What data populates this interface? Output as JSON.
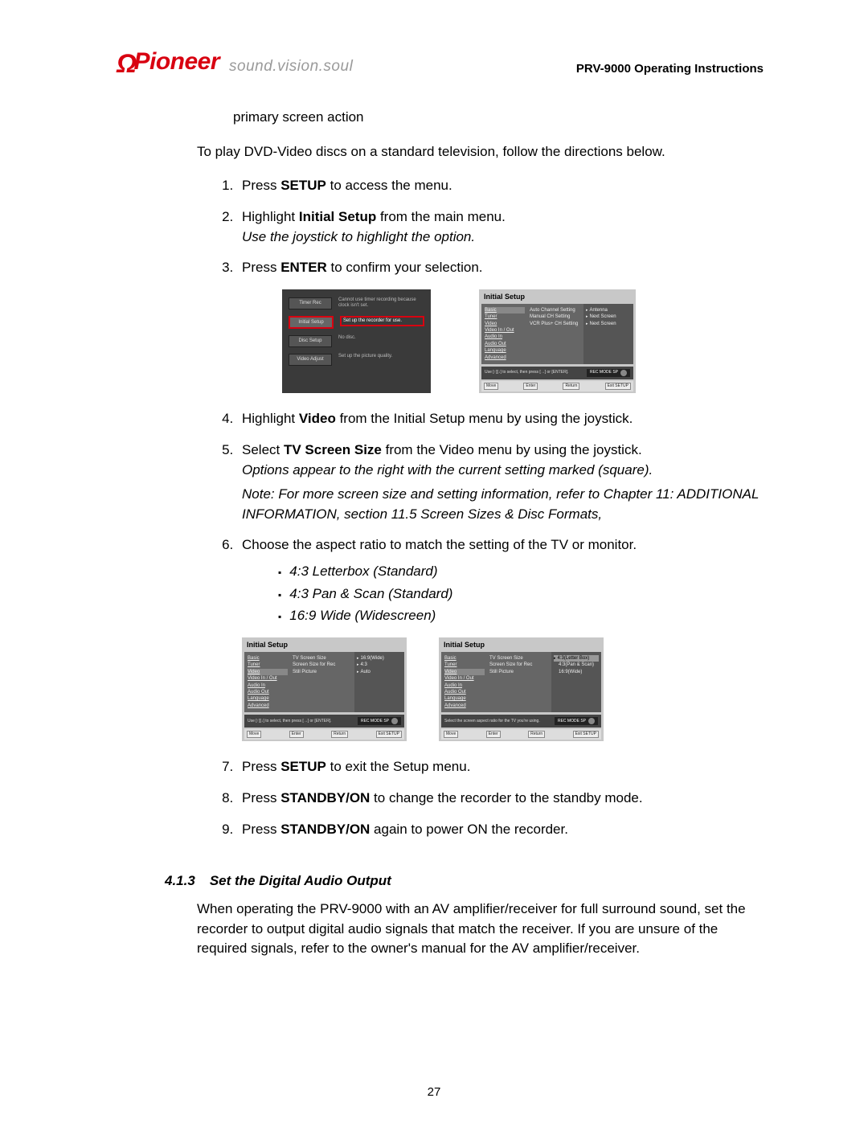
{
  "header": {
    "logo": "Pioneer",
    "tagline": "sound.vision.soul",
    "doc_title": "PRV-9000 Operating Instructions"
  },
  "indent_text": "primary screen action",
  "intro": "To play DVD-Video discs on a standard television, follow the directions below.",
  "steps": {
    "s1_a": "Press ",
    "s1_b": "SETUP",
    "s1_c": " to access the menu.",
    "s2_a": "Highlight ",
    "s2_b": "Initial Setup",
    "s2_c": " from the main menu.",
    "s2_hint": "Use the joystick to highlight the option.",
    "s3_a": "Press ",
    "s3_b": "ENTER",
    "s3_c": " to confirm your selection.",
    "s4_a": "Highlight ",
    "s4_b": "Video",
    "s4_c": " from the Initial Setup menu by using the joystick.",
    "s5_a": "Select ",
    "s5_b": "TV Screen Size",
    "s5_c": " from the Video menu by using the joystick.",
    "s5_hint": "Options appear to the right with the current setting marked (square).",
    "s5_note": "Note: For more screen size and setting information, refer to Chapter 11: ADDITIONAL INFORMATION, section 11.5 Screen Sizes & Disc Formats,",
    "s6": "Choose the aspect ratio to match the setting of the TV or monitor.",
    "s6_b1": "4:3 Letterbox (Standard)",
    "s6_b2": "4:3 Pan & Scan (Standard)",
    "s6_b3": "16:9 Wide (Widescreen)",
    "s7_a": "Press ",
    "s7_b": "SETUP",
    "s7_c": " to exit the Setup menu.",
    "s8_a": "Press ",
    "s8_b": "STANDBY/ON",
    "s8_c": " to change the recorder to the standby mode.",
    "s9_a": "Press ",
    "s9_b": "STANDBY/ON",
    "s9_c": " again to power ON the recorder."
  },
  "subsection": {
    "num": "4.1.3",
    "title": "Set the Digital Audio Output",
    "body": "When operating the PRV-9000 with an AV amplifier/receiver for full surround sound, set the recorder to output digital audio signals that match the receiver. If you are unsure of the required signals, refer to the owner's manual for the AV amplifier/receiver."
  },
  "page_number": "27",
  "fig1": {
    "r1_btn": "Timer Rec",
    "r1_desc": "Cannot use timer recording because clock isn't set.",
    "r2_btn": "Initial Setup",
    "r2_desc": "Set up the recorder for use.",
    "r3_btn": "Disc Setup",
    "r3_desc": "No disc.",
    "r4_btn": "Video Adjust",
    "r4_desc": "Set up the picture quality."
  },
  "fig_common": {
    "title": "Initial Setup",
    "menu_basic": "Basic",
    "menu_tuner": "Tuner",
    "menu_video": "Video",
    "menu_vio": "Video In / Out",
    "menu_ain": "Audio In",
    "menu_aout": "Audio Out",
    "menu_lang": "Language",
    "menu_adv": "Advanced",
    "hint1": "Use [↑][↓] to select, then press [→] or [ENTER].",
    "hint2": "Select the screen aspect ratio for the TV you're using.",
    "rec": "REC MODE SP",
    "ctrl_move": "Move",
    "ctrl_enter": "Enter",
    "ctrl_return": "Return",
    "ctrl_exit": "Exit  SETUP"
  },
  "fig2": {
    "c2_1": "Auto Channel Setting",
    "c2_2": "Manual CH Setting",
    "c2_3": "VCR Plus+ CH Setting",
    "c3_1": "Antenna",
    "c3_2": "Next Screen",
    "c3_3": "Next Screen"
  },
  "fig3": {
    "c2_1": "TV Screen Size",
    "c2_2": "Screen Size for Rec",
    "c2_3": "Still Picture",
    "c3_1": "16:9(Wide)",
    "c3_2": "4:3",
    "c3_3": "Auto"
  },
  "fig4": {
    "c3_1": "4:3(Letter Box)",
    "c3_2": "4:3(Pan & Scan)",
    "c3_3": "16:9(Wide)"
  }
}
